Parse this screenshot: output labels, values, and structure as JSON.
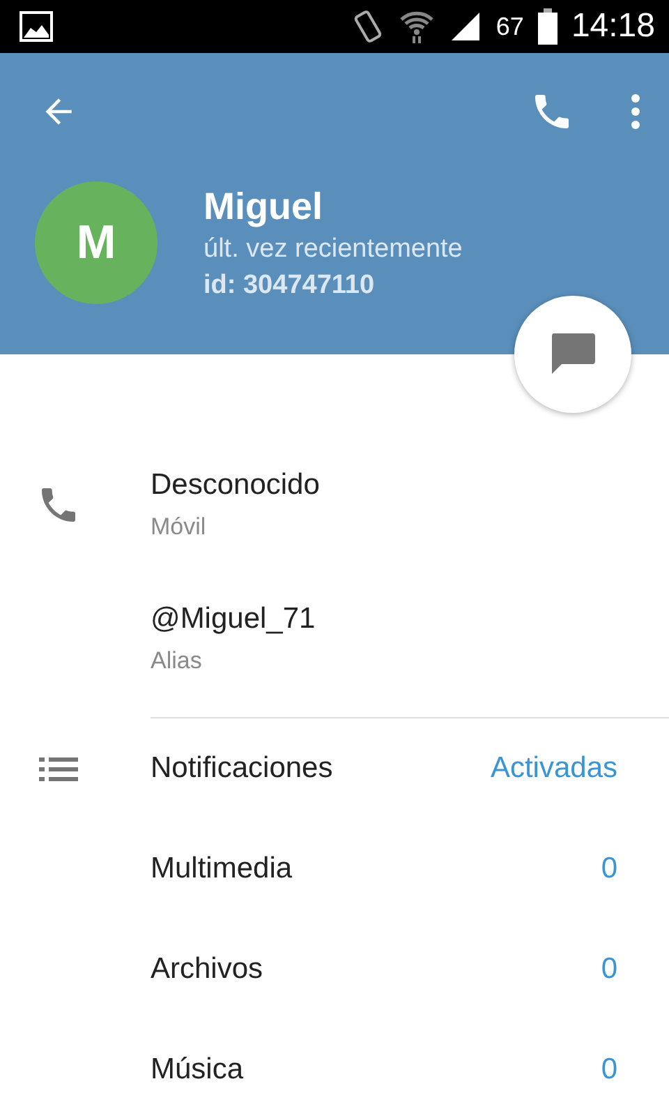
{
  "status_bar": {
    "battery": "67",
    "time": "14:18"
  },
  "profile": {
    "avatar_letter": "M",
    "name": "Miguel",
    "last_seen": "últ. vez recientemente",
    "id": "id: 304747110"
  },
  "info_rows": [
    {
      "kind": "phone",
      "primary": "Desconocido",
      "secondary": "Móvil"
    },
    {
      "kind": "plain",
      "primary": "@Miguel_71",
      "secondary": "Alias"
    }
  ],
  "settings_rows": [
    {
      "kind": "list",
      "label": "Notificaciones",
      "value": "Activadas"
    },
    {
      "kind": "plain",
      "label": "Multimedia",
      "value": "0"
    },
    {
      "kind": "plain",
      "label": "Archivos",
      "value": "0"
    },
    {
      "kind": "plain",
      "label": "Música",
      "value": "0"
    }
  ]
}
